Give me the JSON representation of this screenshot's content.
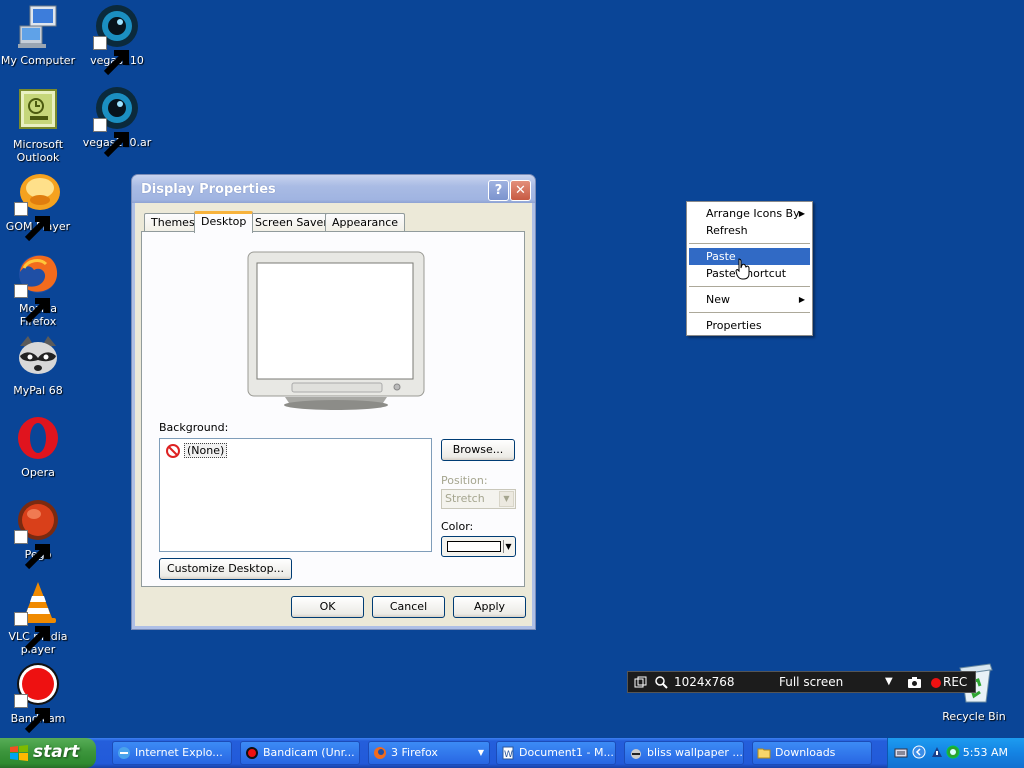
{
  "desktop_icons": [
    {
      "label": "My Computer",
      "icon": "my-computer-icon"
    },
    {
      "label": "vegas110",
      "icon": "vegas-icon"
    },
    {
      "label": "Microsoft Outlook",
      "icon": "outlook-icon"
    },
    {
      "label": "vegas110.ar",
      "icon": "vegas-icon"
    },
    {
      "label": "GOM Player",
      "icon": "gom-player-icon"
    },
    {
      "label": "Mozilla Firefox",
      "icon": "firefox-icon"
    },
    {
      "label": "MyPal 68",
      "icon": "mypal-icon"
    },
    {
      "label": "Opera",
      "icon": "opera-icon"
    },
    {
      "label": "Pego",
      "icon": "pego-icon"
    },
    {
      "label": "VLC media player",
      "icon": "vlc-icon"
    },
    {
      "label": "Bandicam",
      "icon": "bandicam-icon"
    },
    {
      "label": "Recycle Bin",
      "icon": "recycle-bin-icon"
    }
  ],
  "dialog": {
    "title": "Display Properties",
    "help_glyph": "?",
    "close_glyph": "✕",
    "tabs": [
      "Themes",
      "Desktop",
      "Screen Saver",
      "Appearance"
    ],
    "active_tab": "Desktop",
    "background_label": "Background:",
    "background_items": [
      "(None)"
    ],
    "browse_label": "Browse...",
    "position_label": "Position:",
    "position_value": "Stretch",
    "color_label": "Color:",
    "color_value": "#ffffff",
    "customize_label": "Customize Desktop...",
    "ok_label": "OK",
    "cancel_label": "Cancel",
    "apply_label": "Apply"
  },
  "context_menu": {
    "items": [
      {
        "label": "Arrange Icons By",
        "submenu": true
      },
      {
        "label": "Refresh"
      },
      {
        "label": "Paste",
        "highlighted": true
      },
      {
        "label": "Paste Shortcut"
      },
      {
        "label": "New",
        "submenu": true
      },
      {
        "label": "Properties"
      }
    ]
  },
  "recorder_bar": {
    "resolution": "1024x768",
    "mode": "Full screen",
    "rec_label": "REC"
  },
  "taskbar": {
    "start_label": "start",
    "buttons": [
      "Internet Explo...",
      "Bandicam (Unr...",
      "3 Firefox",
      "Document1 - M...",
      "bliss wallpaper ...",
      "Downloads"
    ],
    "clock": "5:53 AM"
  },
  "colors": {
    "desktop": "#0a4597",
    "selection": "#316ac5",
    "taskbar": "#245edb",
    "start": "#3c953c"
  }
}
